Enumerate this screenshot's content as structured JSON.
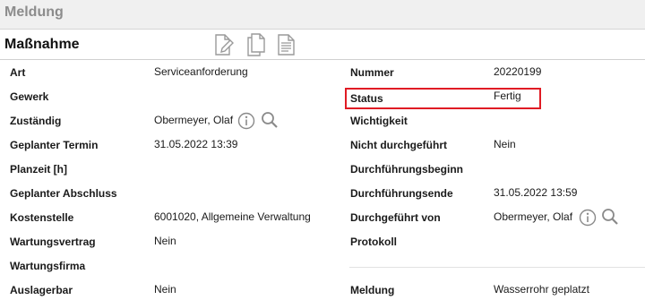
{
  "window": {
    "title": "Meldung"
  },
  "section": {
    "title": "Maßnahme",
    "toolbar_icons": [
      "edit-document-icon",
      "copy-document-icon",
      "text-document-icon"
    ]
  },
  "left": {
    "art": {
      "label": "Art",
      "value": "Serviceanforderung"
    },
    "gewerk": {
      "label": "Gewerk",
      "value": ""
    },
    "zustaendig": {
      "label": "Zuständig",
      "value": "Obermeyer, Olaf"
    },
    "geplanter_termin": {
      "label": "Geplanter Termin",
      "value": "31.05.2022 13:39"
    },
    "planzeit": {
      "label": "Planzeit [h]",
      "value": ""
    },
    "geplanter_abschluss": {
      "label": "Geplanter Abschluss",
      "value": ""
    },
    "kostenstelle": {
      "label": "Kostenstelle",
      "value": "6001020, Allgemeine Verwaltung"
    },
    "wartungsvertrag": {
      "label": "Wartungsvertrag",
      "value": "Nein"
    },
    "wartungsfirma": {
      "label": "Wartungsfirma",
      "value": ""
    },
    "auslagerbar": {
      "label": "Auslagerbar",
      "value": "Nein"
    }
  },
  "right": {
    "nummer": {
      "label": "Nummer",
      "value": "20220199"
    },
    "status": {
      "label": "Status",
      "value": "Fertig"
    },
    "wichtigkeit": {
      "label": "Wichtigkeit",
      "value": ""
    },
    "nicht_durchgefuehrt": {
      "label": "Nicht durchgeführt",
      "value": "Nein"
    },
    "durchfuehrungsbeginn": {
      "label": "Durchführungsbeginn",
      "value": ""
    },
    "durchfuehrungsende": {
      "label": "Durchführungsende",
      "value": "31.05.2022 13:59"
    },
    "durchgefuehrt_von": {
      "label": "Durchgeführt von",
      "value": "Obermeyer, Olaf"
    },
    "protokoll": {
      "label": "Protokoll",
      "value": ""
    },
    "meldung": {
      "label": "Meldung",
      "value": "Wasserrohr geplatzt"
    }
  },
  "colors": {
    "highlight": "#e01b24",
    "icon": "#8a8a8a",
    "topbar": "#f0f0f0"
  }
}
